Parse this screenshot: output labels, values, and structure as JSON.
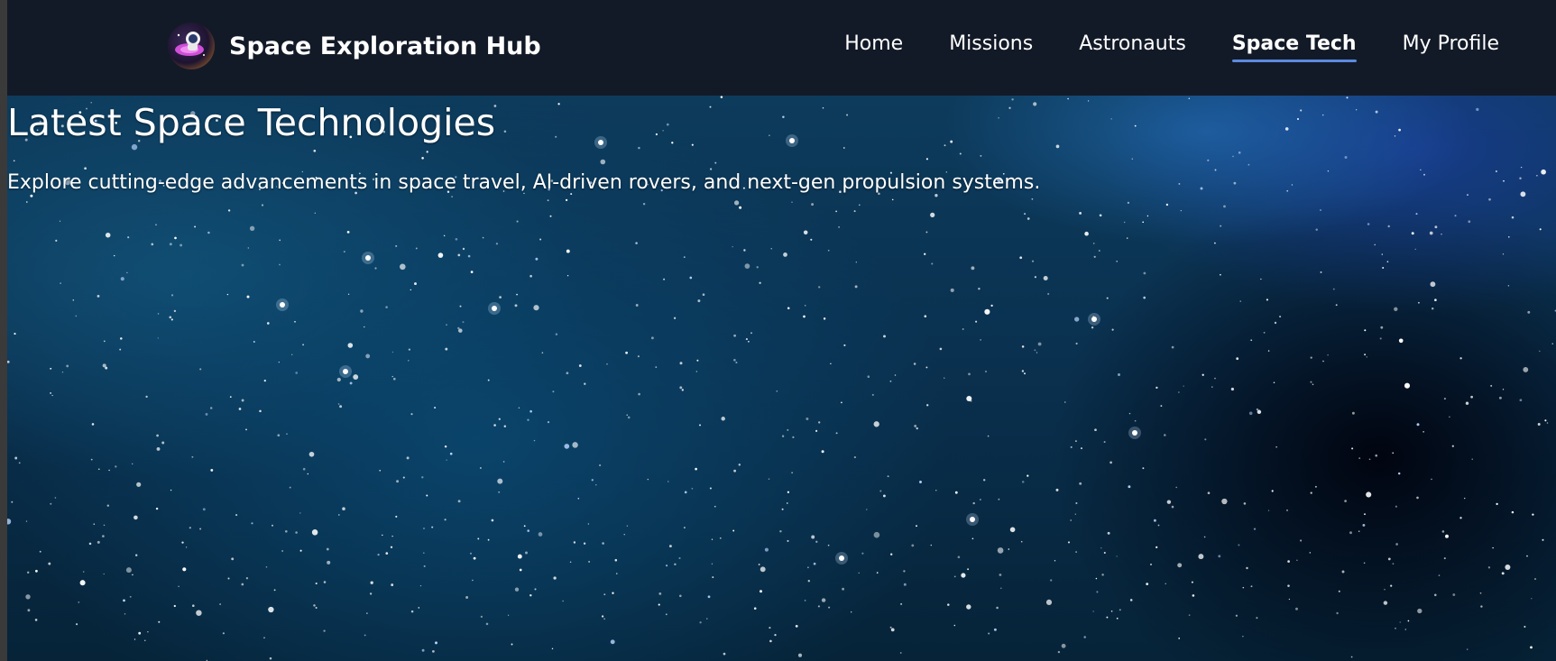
{
  "brand": {
    "title": "Space Exploration Hub",
    "logo_icon": "astronaut-rocket-logo"
  },
  "nav": {
    "items": [
      {
        "label": "Home",
        "active": false
      },
      {
        "label": "Missions",
        "active": false
      },
      {
        "label": "Astronauts",
        "active": false
      },
      {
        "label": "Space Tech",
        "active": true
      },
      {
        "label": "My Profile",
        "active": false
      }
    ],
    "active_underline_color": "#5b8ae0"
  },
  "hero": {
    "title": "Latest Space Technologies",
    "subtitle": "Explore cutting-edge advancements in space travel, AI-driven rovers, and next-gen propulsion systems.",
    "background": "starfield-nebula"
  },
  "colors": {
    "navbar_bg": "#131a27",
    "text": "#ffffff"
  }
}
